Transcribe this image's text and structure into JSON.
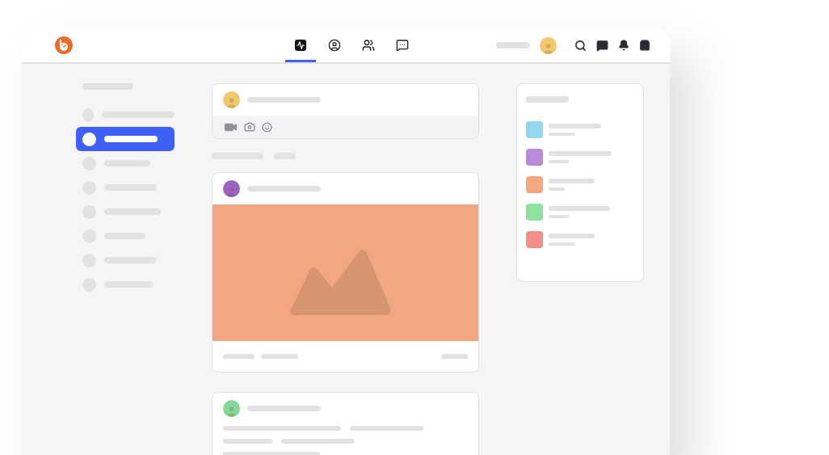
{
  "nav_tabs": [
    {
      "kind": "activity",
      "selected": true
    },
    {
      "kind": "profile",
      "selected": false
    },
    {
      "kind": "people",
      "selected": false
    },
    {
      "kind": "messages",
      "selected": false
    }
  ],
  "sidebar": {
    "items": [
      {
        "selected": false
      },
      {
        "selected": true
      },
      {
        "selected": false
      },
      {
        "selected": false
      },
      {
        "selected": false
      },
      {
        "selected": false
      },
      {
        "selected": false
      },
      {
        "selected": false
      }
    ]
  },
  "composer": {
    "color": "#f2c86e"
  },
  "posts": [
    {
      "kind": "picture",
      "color": "#9b63c4"
    },
    {
      "kind": "text",
      "color": "#86d99a"
    }
  ],
  "groups": [
    {
      "color": "#93d6f0"
    },
    {
      "color": "#b98ad9"
    },
    {
      "color": "#f2a782"
    },
    {
      "color": "#8ee3a0"
    },
    {
      "color": "#f58e88"
    }
  ]
}
